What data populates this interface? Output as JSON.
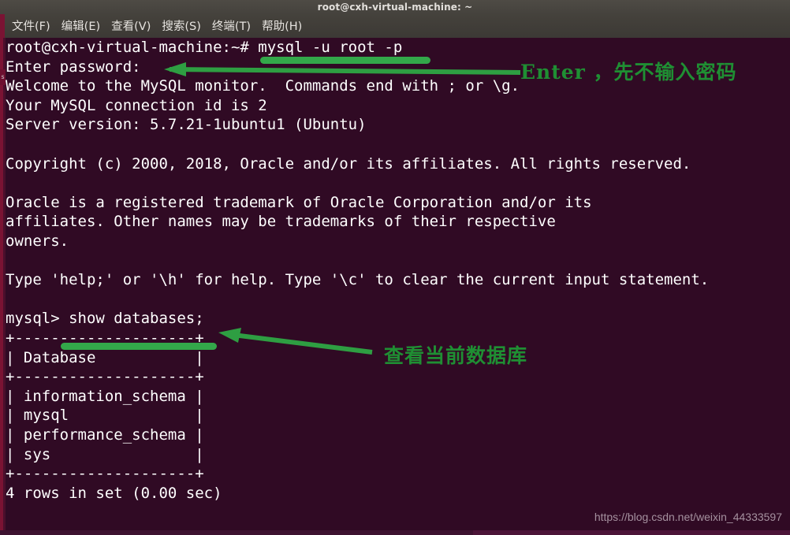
{
  "window": {
    "title": "root@cxh-virtual-machine: ~"
  },
  "menubar": {
    "items": [
      {
        "label": "文件(F)",
        "name": "menu-file"
      },
      {
        "label": "编辑(E)",
        "name": "menu-edit"
      },
      {
        "label": "查看(V)",
        "name": "menu-view"
      },
      {
        "label": "搜索(S)",
        "name": "menu-search"
      },
      {
        "label": "终端(T)",
        "name": "menu-terminal"
      },
      {
        "label": "帮助(H)",
        "name": "menu-help"
      }
    ]
  },
  "terminal": {
    "prompt_user": "root@cxh-virtual-machine",
    "lines": [
      "root@cxh-virtual-machine:~# mysql -u root -p",
      "Enter password:",
      "Welcome to the MySQL monitor.  Commands end with ; or \\g.",
      "Your MySQL connection id is 2",
      "Server version: 5.7.21-1ubuntu1 (Ubuntu)",
      "",
      "Copyright (c) 2000, 2018, Oracle and/or its affiliates. All rights reserved.",
      "",
      "Oracle is a registered trademark of Oracle Corporation and/or its",
      "affiliates. Other names may be trademarks of their respective",
      "owners.",
      "",
      "Type 'help;' or '\\h' for help. Type '\\c' to clear the current input statement.",
      "",
      "mysql> show databases;",
      "+--------------------+",
      "| Database           |",
      "+--------------------+",
      "| information_schema |",
      "| mysql              |",
      "| performance_schema |",
      "| sys                |",
      "+--------------------+",
      "4 rows in set (0.00 sec)"
    ],
    "command_1": "mysql -u root -p",
    "command_2": "show databases;",
    "result_table": {
      "header": "Database",
      "rows": [
        "information_schema",
        "mysql",
        "performance_schema",
        "sys"
      ],
      "row_count_text": "4 rows in set (0.00 sec)"
    }
  },
  "annotations": [
    {
      "text": "Enter ，先不输入密码",
      "name": "annotation-enter-password"
    },
    {
      "text": "查看当前数据库",
      "name": "annotation-show-databases"
    }
  ],
  "watermark": {
    "text": "https://blog.csdn.net/weixin_44333597"
  },
  "colors": {
    "terminal_background": "#300a24",
    "terminal_text": "#ffffff",
    "titlebar": "#4a4742",
    "menubar": "#413e39",
    "annotation_green": "#1f8f33",
    "highlight_green": "#33a84a",
    "window_edge": "#7a1333"
  }
}
